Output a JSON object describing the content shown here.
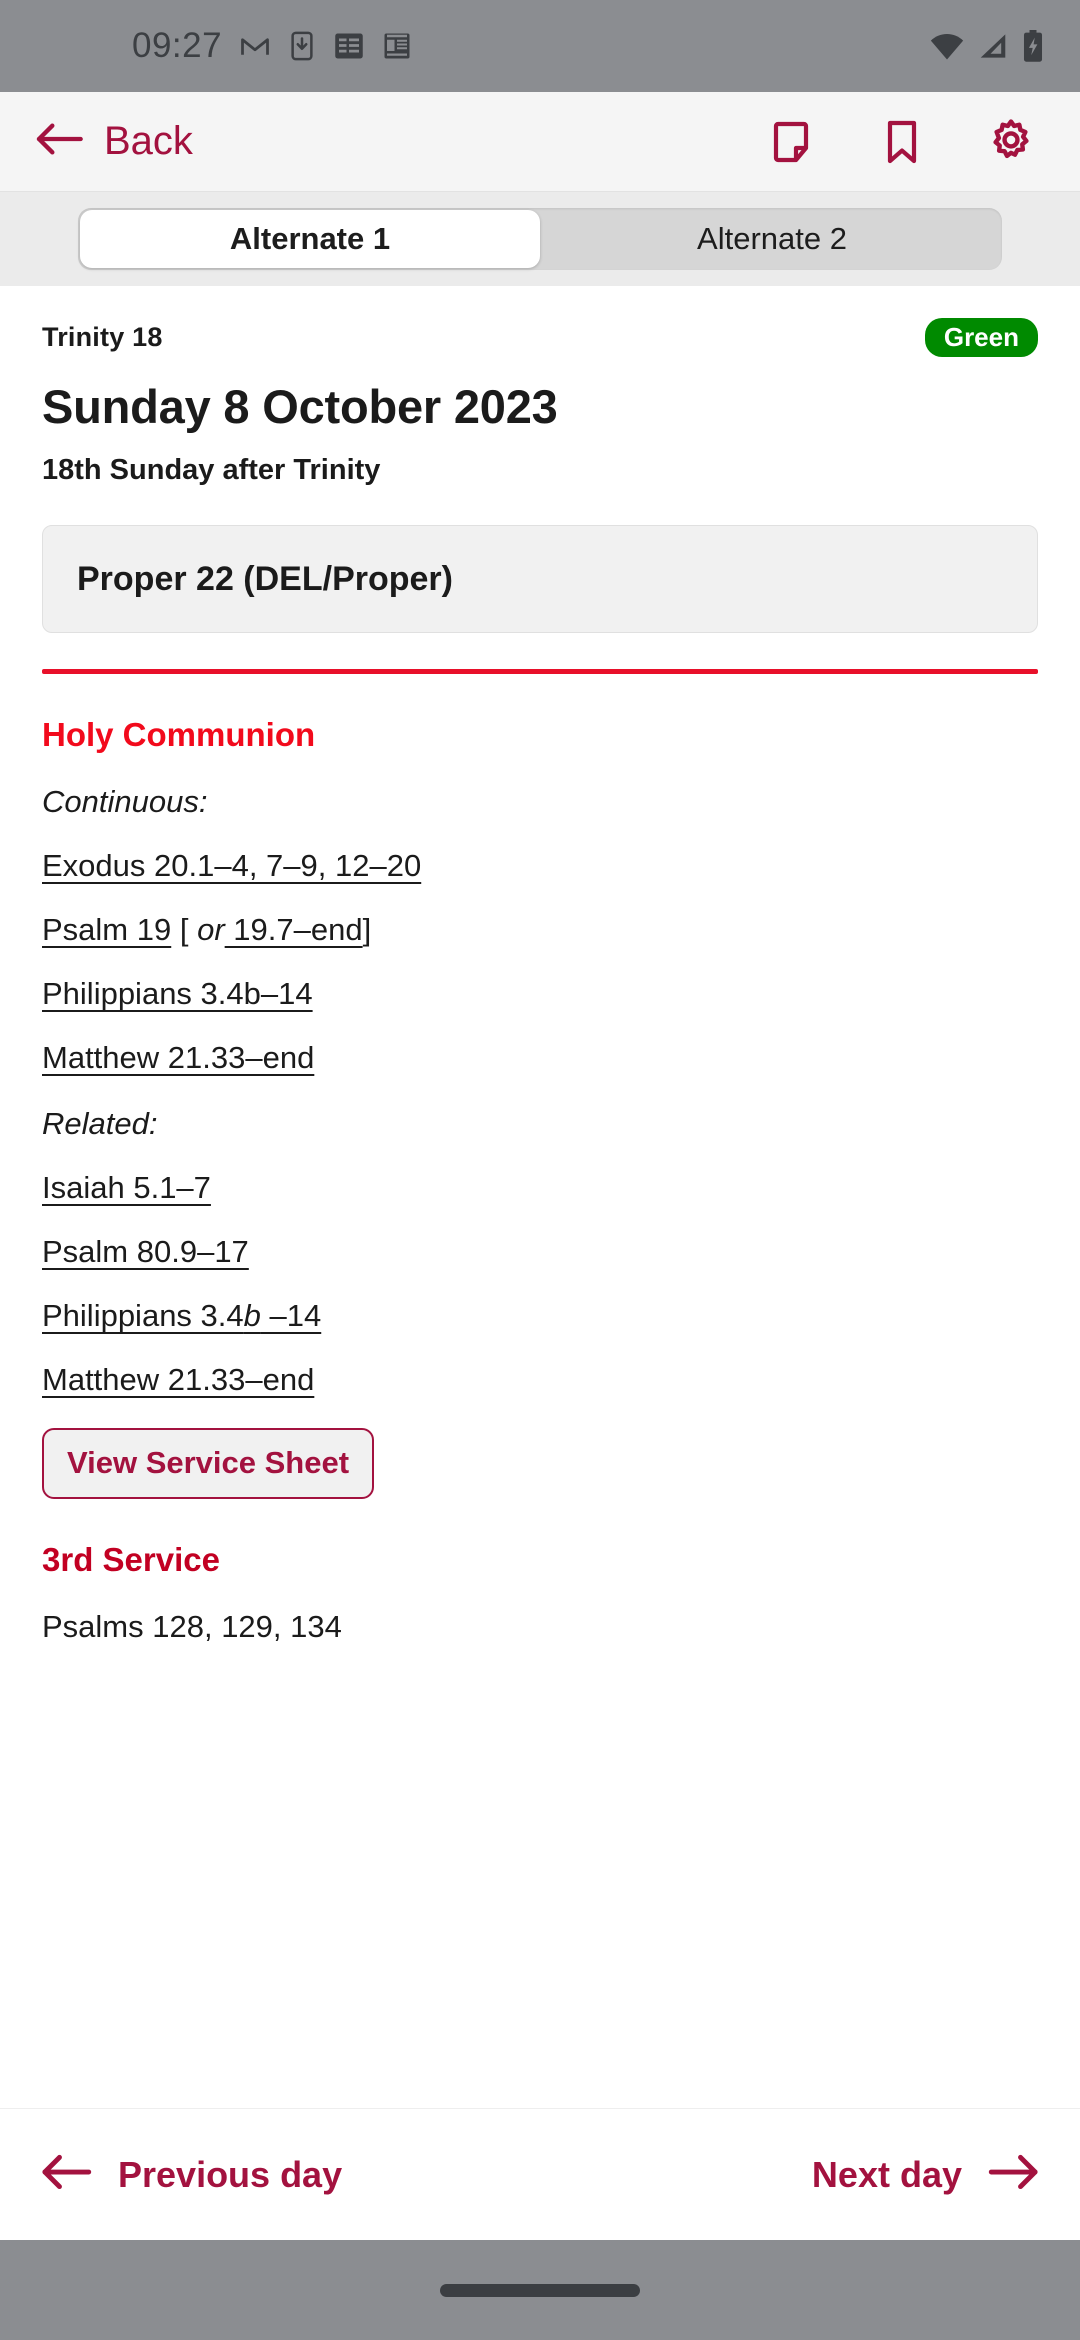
{
  "theme": {
    "brand": "#a3123f",
    "accent_red": "#e8102a",
    "service_red": "#f20a1c",
    "badge_green": "#008a00",
    "statusbar_bg": "#8b8d91"
  },
  "statusbar": {
    "time": "09:27",
    "left_icons": [
      "gmail-icon",
      "download-to-phone-icon",
      "google-news-icon",
      "calculator-icon"
    ],
    "right_icons": [
      "wifi-icon",
      "cellular-signal-icon",
      "battery-charging-icon"
    ]
  },
  "appbar": {
    "back_label": "Back",
    "actions": [
      "note-icon",
      "bookmark-icon",
      "gear-icon"
    ]
  },
  "tabs": {
    "items": [
      {
        "label": "Alternate 1",
        "active": true
      },
      {
        "label": "Alternate 2",
        "active": false
      }
    ]
  },
  "day": {
    "season": "Trinity 18",
    "colour_badge": "Green",
    "title": "Sunday 8 October 2023",
    "subtitle": "18th Sunday after Trinity",
    "proper": "Proper 22 (DEL/Proper)"
  },
  "services": [
    {
      "name": "Holy Communion",
      "groups": [
        {
          "label": "Continuous:",
          "readings": [
            {
              "text": "Exodus 20.1–4, 7–9, 12–20",
              "link": true
            },
            {
              "text": "Psalm 19",
              "link": true,
              "suffix_open": " [ ",
              "suffix_italic": "or",
              "suffix_link": " 19.7–end",
              "suffix_close": "]"
            },
            {
              "text": "Philippians 3.4b–14",
              "link": true
            },
            {
              "text": "Matthew 21.33–end",
              "link": true
            }
          ]
        },
        {
          "label": "Related:",
          "readings": [
            {
              "text": "Isaiah 5.1–7",
              "link": true
            },
            {
              "text": "Psalm 80.9–17",
              "link": true
            },
            {
              "text": "Philippians 3.4",
              "italic_part": "b",
              "tail": " –14",
              "link": true
            },
            {
              "text": "Matthew 21.33–end",
              "link": true
            }
          ]
        }
      ],
      "button": "View Service Sheet"
    },
    {
      "name": "3rd Service",
      "first_line": "Psalms 128, 129, 134"
    }
  ],
  "bottomnav": {
    "previous": "Previous day",
    "next": "Next day"
  }
}
